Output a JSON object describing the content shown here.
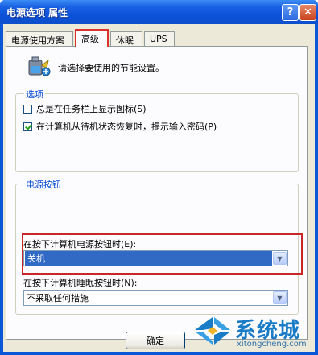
{
  "window": {
    "title": "电源选项 属性",
    "help_glyph": "?",
    "close_glyph": "✕"
  },
  "tabs": [
    {
      "label": "电源使用方案",
      "active": false
    },
    {
      "label": "高级",
      "active": true
    },
    {
      "label": "休眠",
      "active": false
    },
    {
      "label": "UPS",
      "active": false
    }
  ],
  "advanced": {
    "intro": "请选择要使用的节能设置。",
    "options_group": {
      "title": "选项",
      "show_icon": {
        "label": "总是在任务栏上显示图标(S)",
        "checked": false
      },
      "prompt_password": {
        "label": "在计算机从待机状态恢复时，提示输入密码(P)",
        "checked": true
      }
    },
    "power_buttons_group": {
      "title": "电源按钮",
      "power_button_label": "在按下计算机电源按钮时(E):",
      "power_button_value": "关机",
      "sleep_button_label": "在按下计算机睡眠按钮时(N):",
      "sleep_button_value": "不采取任何措施"
    }
  },
  "footer": {
    "ok_label": "确定"
  },
  "watermark": {
    "brand": "系统城",
    "url": "xitongcheng.com"
  },
  "colors": {
    "title_bar": "#0b50d8",
    "highlight": "#c62828",
    "selection": "#316ac5",
    "group_title": "#0046d5"
  }
}
